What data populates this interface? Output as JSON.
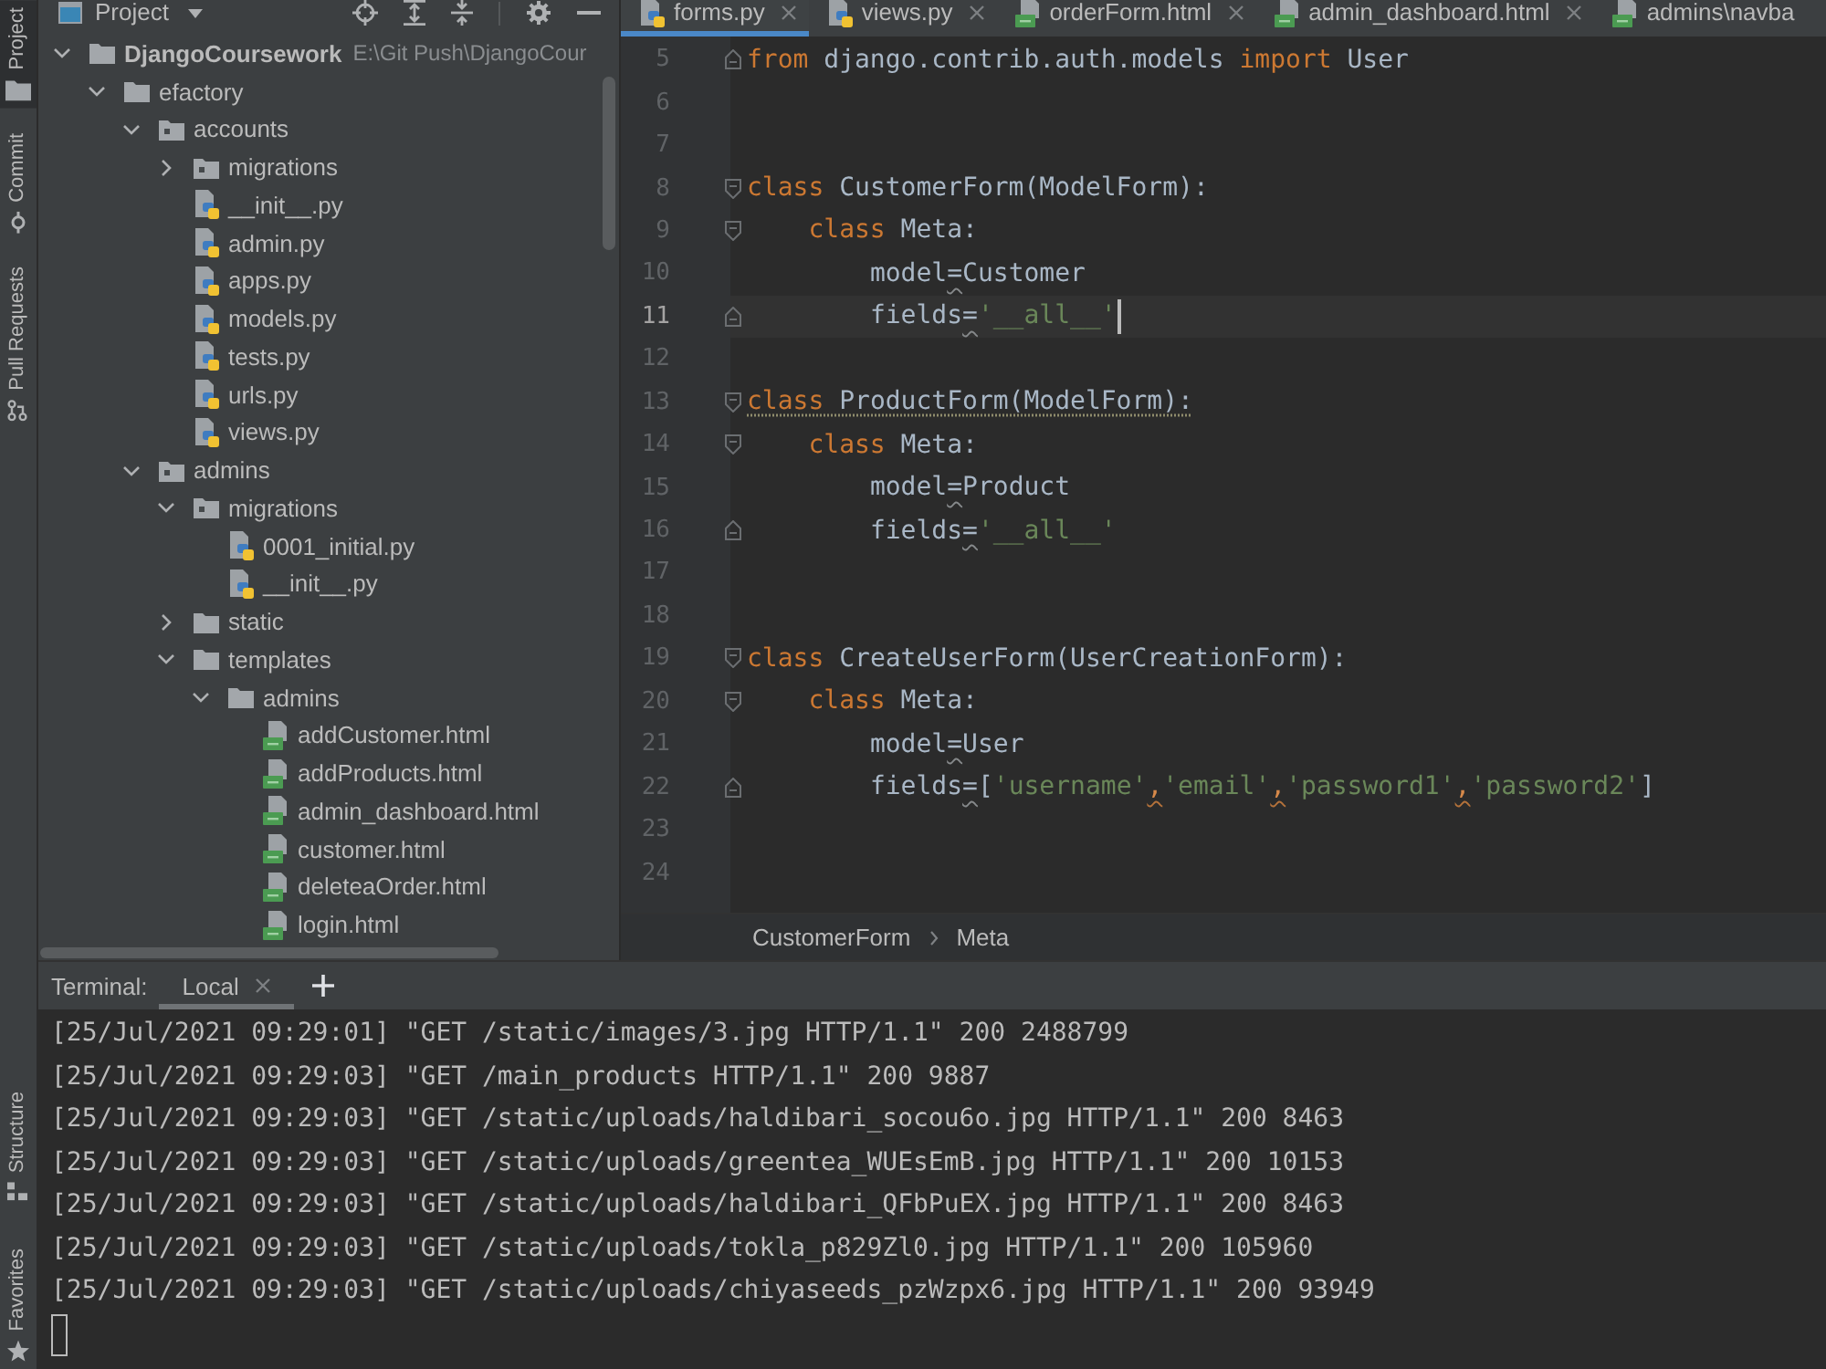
{
  "tool_strip": {
    "top": [
      {
        "label": "Project",
        "kind": "project",
        "selected": true
      },
      {
        "label": "Commit",
        "kind": "commit",
        "selected": false
      },
      {
        "label": "Pull Requests",
        "kind": "pull_requests",
        "selected": false
      }
    ],
    "bottom": [
      {
        "label": "Structure",
        "kind": "structure",
        "selected": false
      },
      {
        "label": "Favorites",
        "kind": "favorites",
        "selected": false
      }
    ]
  },
  "project_panel": {
    "title": "Project",
    "tree": [
      {
        "label": "DjangoCoursework",
        "kind": "folder",
        "expanded": true,
        "path": "E:\\Git Push\\DjangoCour",
        "children": [
          {
            "label": "efactory",
            "kind": "folder",
            "expanded": true,
            "children": [
              {
                "label": "accounts",
                "kind": "package",
                "expanded": true,
                "children": [
                  {
                    "label": "migrations",
                    "kind": "package",
                    "expanded": false
                  },
                  {
                    "label": "__init__.py",
                    "kind": "python"
                  },
                  {
                    "label": "admin.py",
                    "kind": "python"
                  },
                  {
                    "label": "apps.py",
                    "kind": "python"
                  },
                  {
                    "label": "models.py",
                    "kind": "python"
                  },
                  {
                    "label": "tests.py",
                    "kind": "python"
                  },
                  {
                    "label": "urls.py",
                    "kind": "python"
                  },
                  {
                    "label": "views.py",
                    "kind": "python"
                  }
                ]
              },
              {
                "label": "admins",
                "kind": "package",
                "expanded": true,
                "children": [
                  {
                    "label": "migrations",
                    "kind": "package",
                    "expanded": true,
                    "children": [
                      {
                        "label": "0001_initial.py",
                        "kind": "python"
                      },
                      {
                        "label": "__init__.py",
                        "kind": "python"
                      }
                    ]
                  },
                  {
                    "label": "static",
                    "kind": "folder",
                    "expanded": false
                  },
                  {
                    "label": "templates",
                    "kind": "folder",
                    "expanded": true,
                    "children": [
                      {
                        "label": "admins",
                        "kind": "folder",
                        "expanded": true,
                        "children": [
                          {
                            "label": "addCustomer.html",
                            "kind": "html"
                          },
                          {
                            "label": "addProducts.html",
                            "kind": "html"
                          },
                          {
                            "label": "admin_dashboard.html",
                            "kind": "html"
                          },
                          {
                            "label": "customer.html",
                            "kind": "html"
                          },
                          {
                            "label": "deleteaOrder.html",
                            "kind": "html"
                          },
                          {
                            "label": "login.html",
                            "kind": "html"
                          }
                        ]
                      }
                    ]
                  }
                ]
              }
            ]
          }
        ]
      }
    ]
  },
  "editor": {
    "tabs": [
      {
        "label": "forms.py",
        "kind": "python",
        "selected": true,
        "closable": true
      },
      {
        "label": "views.py",
        "kind": "python",
        "selected": false,
        "closable": true
      },
      {
        "label": "orderForm.html",
        "kind": "html",
        "selected": false,
        "closable": true
      },
      {
        "label": "admin_dashboard.html",
        "kind": "html",
        "selected": false,
        "closable": true
      },
      {
        "label": "admins\\navba",
        "kind": "html",
        "selected": false,
        "closable": false
      }
    ],
    "lines": [
      {
        "number": "5",
        "current": false,
        "fold_start": false,
        "fold_end": true,
        "tokens": [
          {
            "kind": "keyword",
            "text": "from",
            "warning": false,
            "weak_warning": false
          },
          {
            "kind": "plain",
            "text": " django.contrib.auth.models ",
            "warning": false,
            "weak_warning": false
          },
          {
            "kind": "keyword",
            "text": "import",
            "warning": false,
            "weak_warning": false
          },
          {
            "kind": "plain",
            "text": " User",
            "warning": false,
            "weak_warning": false
          }
        ]
      },
      {
        "number": "6",
        "current": false,
        "fold_start": false,
        "fold_end": false
      },
      {
        "number": "7",
        "current": false,
        "fold_start": false,
        "fold_end": false
      },
      {
        "number": "8",
        "current": false,
        "fold_start": true,
        "fold_end": false,
        "tokens": [
          {
            "kind": "keyword",
            "text": "class",
            "warning": false,
            "weak_warning": false
          },
          {
            "kind": "plain",
            "text": " CustomerForm(ModelForm):",
            "warning": false,
            "weak_warning": false
          }
        ]
      },
      {
        "number": "9",
        "current": false,
        "fold_start": true,
        "fold_end": false,
        "tokens": [
          {
            "kind": "keyword",
            "text": "    class",
            "warning": false,
            "weak_warning": false
          },
          {
            "kind": "plain",
            "text": " Meta:",
            "warning": false,
            "weak_warning": false
          }
        ]
      },
      {
        "number": "10",
        "current": false,
        "fold_start": false,
        "fold_end": false,
        "tokens": [
          {
            "kind": "plain",
            "text": "        model",
            "warning": false,
            "weak_warning": false
          },
          {
            "kind": "plain",
            "text": "=",
            "warning": true,
            "weak_warning": false
          },
          {
            "kind": "plain",
            "text": "Customer",
            "warning": false,
            "weak_warning": false
          }
        ]
      },
      {
        "number": "11",
        "current": true,
        "fold_start": false,
        "fold_end": true,
        "tokens": [
          {
            "kind": "plain",
            "text": "        fields",
            "warning": false,
            "weak_warning": false
          },
          {
            "kind": "plain",
            "text": "=",
            "warning": true,
            "weak_warning": false
          },
          {
            "kind": "string",
            "text": "'__all__'",
            "warning": false,
            "weak_warning": false
          }
        ]
      },
      {
        "number": "12",
        "current": false,
        "fold_start": false,
        "fold_end": false
      },
      {
        "number": "13",
        "current": false,
        "fold_start": true,
        "fold_end": false,
        "tokens": [
          {
            "kind": "keyword",
            "text": "class",
            "warning": false,
            "weak_warning": true
          },
          {
            "kind": "plain",
            "text": " ProductForm(ModelForm):",
            "warning": false,
            "weak_warning": true
          }
        ]
      },
      {
        "number": "14",
        "current": false,
        "fold_start": true,
        "fold_end": false,
        "tokens": [
          {
            "kind": "keyword",
            "text": "    class",
            "warning": false,
            "weak_warning": false
          },
          {
            "kind": "plain",
            "text": " Meta:",
            "warning": false,
            "weak_warning": false
          }
        ]
      },
      {
        "number": "15",
        "current": false,
        "fold_start": false,
        "fold_end": false,
        "tokens": [
          {
            "kind": "plain",
            "text": "        model",
            "warning": false,
            "weak_warning": false
          },
          {
            "kind": "plain",
            "text": "=",
            "warning": true,
            "weak_warning": false
          },
          {
            "kind": "plain",
            "text": "Product",
            "warning": false,
            "weak_warning": false
          }
        ]
      },
      {
        "number": "16",
        "current": false,
        "fold_start": false,
        "fold_end": true,
        "tokens": [
          {
            "kind": "plain",
            "text": "        fields",
            "warning": false,
            "weak_warning": false
          },
          {
            "kind": "plain",
            "text": "=",
            "warning": true,
            "weak_warning": false
          },
          {
            "kind": "string",
            "text": "'__all__'",
            "warning": false,
            "weak_warning": false
          }
        ]
      },
      {
        "number": "17",
        "current": false,
        "fold_start": false,
        "fold_end": false
      },
      {
        "number": "18",
        "current": false,
        "fold_start": false,
        "fold_end": false
      },
      {
        "number": "19",
        "current": false,
        "fold_start": true,
        "fold_end": false,
        "tokens": [
          {
            "kind": "keyword",
            "text": "class",
            "warning": false,
            "weak_warning": false
          },
          {
            "kind": "plain",
            "text": " CreateUserForm(UserCreationForm):",
            "warning": false,
            "weak_warning": false
          }
        ]
      },
      {
        "number": "20",
        "current": false,
        "fold_start": true,
        "fold_end": false,
        "tokens": [
          {
            "kind": "keyword",
            "text": "    class",
            "warning": false,
            "weak_warning": false
          },
          {
            "kind": "plain",
            "text": " Meta:",
            "warning": false,
            "weak_warning": false
          }
        ]
      },
      {
        "number": "21",
        "current": false,
        "fold_start": false,
        "fold_end": false,
        "tokens": [
          {
            "kind": "plain",
            "text": "        model",
            "warning": false,
            "weak_warning": false
          },
          {
            "kind": "plain",
            "text": "=",
            "warning": true,
            "weak_warning": false
          },
          {
            "kind": "plain",
            "text": "User",
            "warning": false,
            "weak_warning": false
          }
        ]
      },
      {
        "number": "22",
        "current": false,
        "fold_start": false,
        "fold_end": true,
        "tokens": [
          {
            "kind": "plain",
            "text": "        fields",
            "warning": false,
            "weak_warning": false
          },
          {
            "kind": "plain",
            "text": "=",
            "warning": true,
            "weak_warning": false
          },
          {
            "kind": "plain",
            "text": "[",
            "warning": false,
            "weak_warning": false
          },
          {
            "kind": "string",
            "text": "'username'",
            "warning": false,
            "weak_warning": false
          },
          {
            "kind": "punctuation",
            "text": ",",
            "warning": true,
            "weak_warning": false
          },
          {
            "kind": "string",
            "text": "'email'",
            "warning": false,
            "weak_warning": false
          },
          {
            "kind": "punctuation",
            "text": ",",
            "warning": true,
            "weak_warning": false
          },
          {
            "kind": "string",
            "text": "'password1'",
            "warning": false,
            "weak_warning": false
          },
          {
            "kind": "punctuation",
            "text": ",",
            "warning": true,
            "weak_warning": false
          },
          {
            "kind": "string",
            "text": "'password2'",
            "warning": false,
            "weak_warning": false
          },
          {
            "kind": "plain",
            "text": "]",
            "warning": false,
            "weak_warning": false
          }
        ]
      },
      {
        "number": "23",
        "current": false,
        "fold_start": false,
        "fold_end": false
      },
      {
        "number": "24",
        "current": false,
        "fold_start": false,
        "fold_end": false
      }
    ],
    "breadcrumbs": [
      "CustomerForm",
      "Meta"
    ]
  },
  "terminal": {
    "title": "Terminal:",
    "tabs": [
      {
        "label": "Local",
        "selected": true,
        "closable": true
      }
    ],
    "lines": [
      "[25/Jul/2021 09:29:01] \"GET /static/images/3.jpg HTTP/1.1\" 200 2488799",
      "[25/Jul/2021 09:29:03] \"GET /main_products HTTP/1.1\" 200 9887",
      "[25/Jul/2021 09:29:03] \"GET /static/uploads/haldibari_socou6o.jpg HTTP/1.1\" 200 8463",
      "[25/Jul/2021 09:29:03] \"GET /static/uploads/greentea_WUEsEmB.jpg HTTP/1.1\" 200 10153",
      "[25/Jul/2021 09:29:03] \"GET /static/uploads/haldibari_QFbPuEX.jpg HTTP/1.1\" 200 8463",
      "[25/Jul/2021 09:29:03] \"GET /static/uploads/tokla_p829Zl0.jpg HTTP/1.1\" 200 105960",
      "[25/Jul/2021 09:29:03] \"GET /static/uploads/chiyaseeds_pzWzpx6.jpg HTTP/1.1\" 200 93949"
    ]
  }
}
